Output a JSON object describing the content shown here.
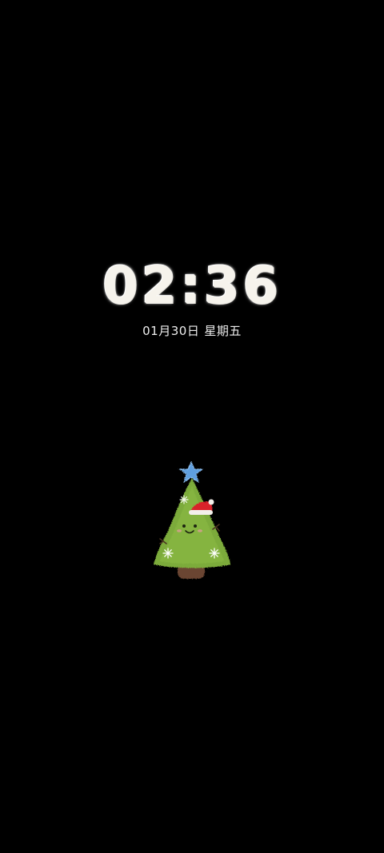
{
  "lockscreen": {
    "time": "02:36",
    "date": "01月30日",
    "weekday": "星期五"
  },
  "decoration": {
    "icon": "christmas-tree-plush-icon",
    "colors": {
      "tree_green": "#7cab3a",
      "star_blue": "#5f9fe0",
      "hat_red": "#d8222a",
      "trunk_brown": "#6b4430"
    }
  },
  "colors": {
    "background": "#000000",
    "clock": "#f6f3ec",
    "date": "#eeeeee"
  }
}
